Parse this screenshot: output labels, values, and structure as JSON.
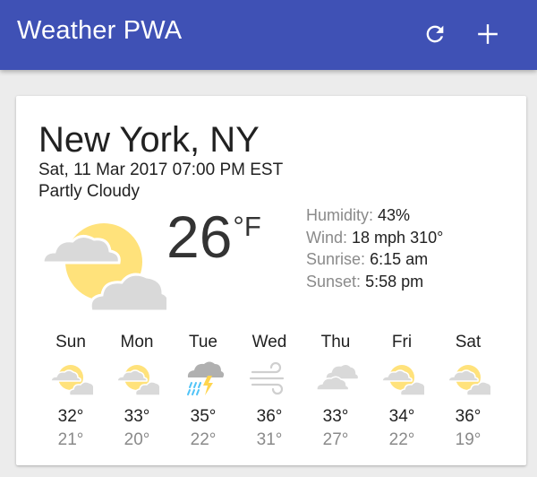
{
  "header": {
    "title": "Weather PWA",
    "refresh_icon": "refresh-icon",
    "add_icon": "add-icon"
  },
  "colors": {
    "header_bg": "#3f51b5",
    "sun": "#ffe27b",
    "cloud": "#d9d9d9",
    "rain": "#4fc3f7",
    "bolt": "#ffd54f"
  },
  "card": {
    "location": "New York, NY",
    "date": "Sat, 11 Mar 2017 07:00 PM EST",
    "description": "Partly Cloudy",
    "current_icon": "partly-cloudy-icon",
    "temperature": "26",
    "scale": "°F",
    "details": {
      "humidity_label": "Humidity:",
      "humidity": "43%",
      "wind_label": "Wind:",
      "wind": "18 mph 310°",
      "sunrise_label": "Sunrise:",
      "sunrise": "6:15 am",
      "sunset_label": "Sunset:",
      "sunset": "5:58 pm"
    }
  },
  "forecast": [
    {
      "day": "Sun",
      "icon": "partly-cloudy-icon",
      "high": "32°",
      "low": "21°"
    },
    {
      "day": "Mon",
      "icon": "partly-cloudy-icon",
      "high": "33°",
      "low": "20°"
    },
    {
      "day": "Tue",
      "icon": "thunderstorm-icon",
      "high": "35°",
      "low": "22°"
    },
    {
      "day": "Wed",
      "icon": "windy-icon",
      "high": "36°",
      "low": "31°"
    },
    {
      "day": "Thu",
      "icon": "cloudy-icon",
      "high": "33°",
      "low": "27°"
    },
    {
      "day": "Fri",
      "icon": "partly-cloudy-icon",
      "high": "34°",
      "low": "22°"
    },
    {
      "day": "Sat",
      "icon": "partly-cloudy-icon",
      "high": "36°",
      "low": "19°"
    }
  ]
}
